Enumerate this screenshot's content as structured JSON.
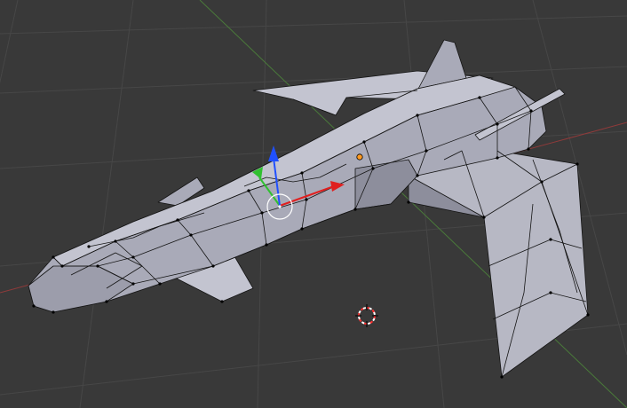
{
  "viewport": {
    "background": "#393939",
    "grid_color": "#474747",
    "x_axis_color": "#8f3a3a",
    "y_axis_color": "#4a7a3a"
  },
  "model": {
    "face_color": "#a9aab8",
    "face_dark": "#8d8e9c",
    "face_light": "#c3c4d0",
    "edge_color": "#151515",
    "vertex_color": "#000000"
  },
  "gizmo": {
    "x_axis_color": "#e02020",
    "y_axis_color": "#30c030",
    "z_axis_color": "#2050ff",
    "pivot_color": "#ff9a20"
  },
  "cursor_3d": {
    "ring_color_a": "#ff3030",
    "ring_color_b": "#ffffff"
  }
}
